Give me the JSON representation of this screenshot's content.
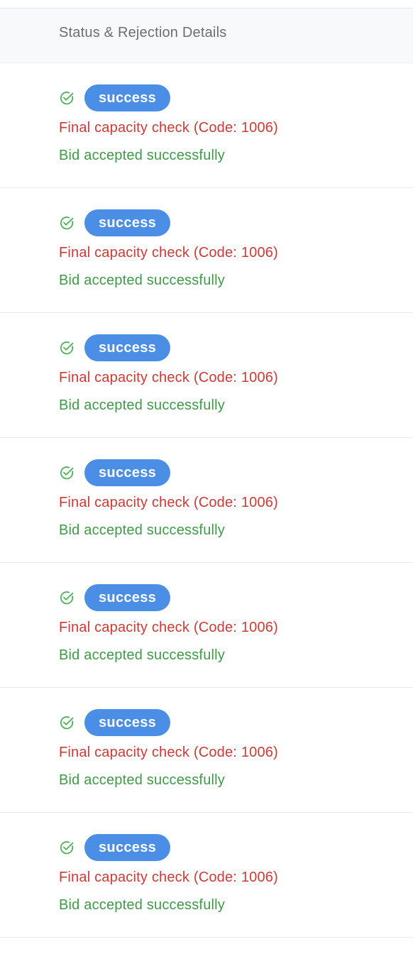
{
  "table": {
    "column_header": "Status & Rejection Details",
    "rows": [
      {
        "status_icon": "check-circle-icon",
        "status": "success",
        "reason": "Final capacity check (Code: 1006)",
        "message": "Bid accepted successfully"
      },
      {
        "status_icon": "check-circle-icon",
        "status": "success",
        "reason": "Final capacity check (Code: 1006)",
        "message": "Bid accepted successfully"
      },
      {
        "status_icon": "check-circle-icon",
        "status": "success",
        "reason": "Final capacity check (Code: 1006)",
        "message": "Bid accepted successfully"
      },
      {
        "status_icon": "check-circle-icon",
        "status": "success",
        "reason": "Final capacity check (Code: 1006)",
        "message": "Bid accepted successfully"
      },
      {
        "status_icon": "check-circle-icon",
        "status": "success",
        "reason": "Final capacity check (Code: 1006)",
        "message": "Bid accepted successfully"
      },
      {
        "status_icon": "check-circle-icon",
        "status": "success",
        "reason": "Final capacity check (Code: 1006)",
        "message": "Bid accepted successfully"
      },
      {
        "status_icon": "check-circle-icon",
        "status": "success",
        "reason": "Final capacity check (Code: 1006)",
        "message": "Bid accepted successfully"
      }
    ]
  },
  "colors": {
    "badge_bg": "#4a8ee6",
    "reason_text": "#cc3a35",
    "message_text": "#3f9a47",
    "icon": "#4fb25a"
  }
}
